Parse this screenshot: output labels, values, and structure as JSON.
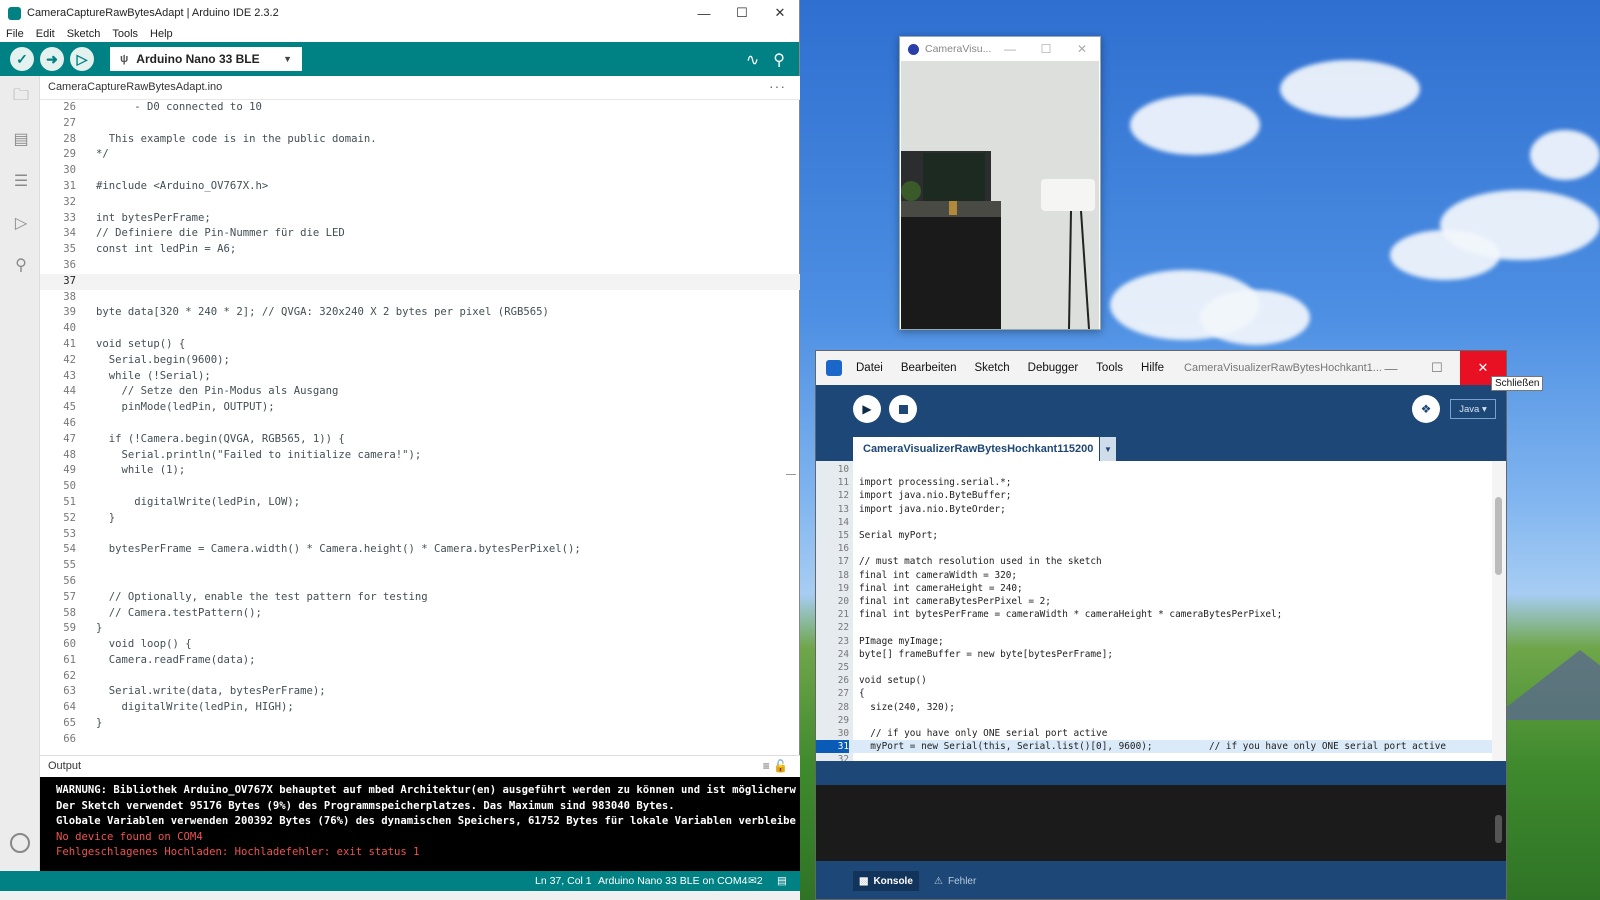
{
  "arduino": {
    "title": "CameraCaptureRawBytesAdapt | Arduino IDE 2.3.2",
    "menu": [
      "File",
      "Edit",
      "Sketch",
      "Tools",
      "Help"
    ],
    "board": "Arduino Nano 33 BLE",
    "file_tab": "CameraCaptureRawBytesAdapt.ino",
    "current_line": 37,
    "code": [
      {
        "n": "26",
        "t": "      - D0 connected to 10"
      },
      {
        "n": "27",
        "t": ""
      },
      {
        "n": "28",
        "t": "  This example code is in the public domain."
      },
      {
        "n": "29",
        "t": "*/"
      },
      {
        "n": "30",
        "t": ""
      },
      {
        "n": "31",
        "t": "#include <Arduino_OV767X.h>"
      },
      {
        "n": "32",
        "t": ""
      },
      {
        "n": "33",
        "t": "int bytesPerFrame;"
      },
      {
        "n": "34",
        "t": "// Definiere die Pin-Nummer für die LED"
      },
      {
        "n": "35",
        "t": "const int ledPin = A6;"
      },
      {
        "n": "36",
        "t": ""
      },
      {
        "n": "37",
        "t": ""
      },
      {
        "n": "38",
        "t": ""
      },
      {
        "n": "39",
        "t": "byte data[320 * 240 * 2]; // QVGA: 320x240 X 2 bytes per pixel (RGB565)"
      },
      {
        "n": "40",
        "t": ""
      },
      {
        "n": "41",
        "t": "void setup() {"
      },
      {
        "n": "42",
        "t": "  Serial.begin(9600);"
      },
      {
        "n": "43",
        "t": "  while (!Serial);"
      },
      {
        "n": "44",
        "t": "    // Setze den Pin-Modus als Ausgang"
      },
      {
        "n": "45",
        "t": "    pinMode(ledPin, OUTPUT);"
      },
      {
        "n": "46",
        "t": ""
      },
      {
        "n": "47",
        "t": "  if (!Camera.begin(QVGA, RGB565, 1)) {"
      },
      {
        "n": "48",
        "t": "    Serial.println(\"Failed to initialize camera!\");"
      },
      {
        "n": "49",
        "t": "    while (1);"
      },
      {
        "n": "50",
        "t": ""
      },
      {
        "n": "51",
        "t": "      digitalWrite(ledPin, LOW);"
      },
      {
        "n": "52",
        "t": "  }"
      },
      {
        "n": "53",
        "t": ""
      },
      {
        "n": "54",
        "t": "  bytesPerFrame = Camera.width() * Camera.height() * Camera.bytesPerPixel();"
      },
      {
        "n": "55",
        "t": ""
      },
      {
        "n": "56",
        "t": ""
      },
      {
        "n": "57",
        "t": "  // Optionally, enable the test pattern for testing"
      },
      {
        "n": "58",
        "t": "  // Camera.testPattern();"
      },
      {
        "n": "59",
        "t": "}"
      },
      {
        "n": "60",
        "t": "  void loop() {"
      },
      {
        "n": "61",
        "t": "  Camera.readFrame(data);"
      },
      {
        "n": "62",
        "t": ""
      },
      {
        "n": "63",
        "t": "  Serial.write(data, bytesPerFrame);"
      },
      {
        "n": "64",
        "t": "    digitalWrite(ledPin, HIGH);"
      },
      {
        "n": "65",
        "t": "}"
      },
      {
        "n": "66",
        "t": ""
      }
    ],
    "output_label": "Output",
    "output": [
      {
        "t": "WARNUNG: Bibliothek Arduino_OV767X behauptet auf mbed Architektur(en) ausgeführt werden zu können und ist möglicherw",
        "err": false
      },
      {
        "t": "Der Sketch verwendet 95176 Bytes (9%) des Programmspeicherplatzes. Das Maximum sind 983040 Bytes.",
        "err": false
      },
      {
        "t": "Globale Variablen verwenden 200392 Bytes (76%) des dynamischen Speichers, 61752 Bytes für lokale Variablen verbleibe",
        "err": false
      },
      {
        "t": "No device found on COM4",
        "err": true
      },
      {
        "t": "Fehlgeschlagenes Hochladen: Hochladefehler: exit status 1",
        "err": true
      }
    ],
    "status": {
      "position": "Ln 37, Col 1",
      "board_port": "Arduino Nano 33 BLE on COM4",
      "notifications": "2"
    }
  },
  "camera": {
    "title": "CameraVisu..."
  },
  "processing": {
    "menu": [
      "Datei",
      "Bearbeiten",
      "Sketch",
      "Debugger",
      "Tools",
      "Hilfe"
    ],
    "title": "CameraVisualizerRawBytesHochkant1...",
    "close_tooltip": "Schließen",
    "mode": "Java ▾",
    "tab": "CameraVisualizerRawBytesHochkant115200",
    "highlight_line": "31",
    "code": [
      {
        "n": "10",
        "t": ""
      },
      {
        "n": "11",
        "t": "import processing.serial.*;"
      },
      {
        "n": "12",
        "t": "import java.nio.ByteBuffer;"
      },
      {
        "n": "13",
        "t": "import java.nio.ByteOrder;"
      },
      {
        "n": "14",
        "t": ""
      },
      {
        "n": "15",
        "t": "Serial myPort;"
      },
      {
        "n": "16",
        "t": ""
      },
      {
        "n": "17",
        "t": "// must match resolution used in the sketch"
      },
      {
        "n": "18",
        "t": "final int cameraWidth = 320;"
      },
      {
        "n": "19",
        "t": "final int cameraHeight = 240;"
      },
      {
        "n": "20",
        "t": "final int cameraBytesPerPixel = 2;"
      },
      {
        "n": "21",
        "t": "final int bytesPerFrame = cameraWidth * cameraHeight * cameraBytesPerPixel;"
      },
      {
        "n": "22",
        "t": ""
      },
      {
        "n": "23",
        "t": "PImage myImage;"
      },
      {
        "n": "24",
        "t": "byte[] frameBuffer = new byte[bytesPerFrame];"
      },
      {
        "n": "25",
        "t": ""
      },
      {
        "n": "26",
        "t": "void setup()"
      },
      {
        "n": "27",
        "t": "{"
      },
      {
        "n": "28",
        "t": "  size(240, 320);"
      },
      {
        "n": "29",
        "t": ""
      },
      {
        "n": "30",
        "t": "  // if you have only ONE serial port active"
      },
      {
        "n": "31",
        "t": "  myPort = new Serial(this, Serial.list()[0], 9600);          // if you have only ONE serial port active"
      },
      {
        "n": "32",
        "t": ""
      }
    ],
    "bottom_tabs": [
      "Konsole",
      "Fehler"
    ]
  },
  "colors": {
    "arduino_teal": "#008184",
    "processing_blue": "#1d4776",
    "error_red": "#ef5350",
    "close_red": "#e81123"
  },
  "icons": {
    "verify": "checkmark-icon",
    "upload": "arrow-right-icon",
    "debug": "debug-icon",
    "serial_plotter": "plotter-icon",
    "serial_monitor": "monitor-icon"
  }
}
